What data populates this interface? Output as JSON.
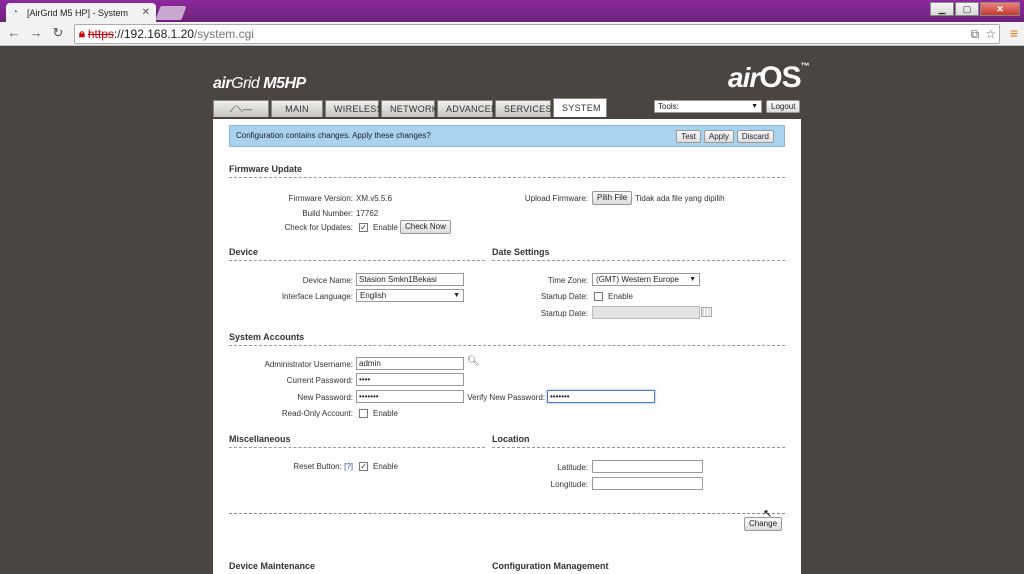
{
  "browser": {
    "tab_title": "[AirGrid M5 HP] - System",
    "url_protocol": "https",
    "url_host": "://192.168.1.20",
    "url_path": "/system.cgi"
  },
  "brand": {
    "left_prefix": "air",
    "left_main": "Grid",
    "left_model": "M5HP",
    "right_prefix": "air",
    "right_main": "OS",
    "right_tm": "™"
  },
  "nav": {
    "tabs": [
      "MAIN",
      "WIRELESS",
      "NETWORK",
      "ADVANCED",
      "SERVICES",
      "SYSTEM"
    ],
    "active": "SYSTEM",
    "tools_label": "Tools:",
    "logout_label": "Logout"
  },
  "notice": {
    "text": "Configuration contains changes. Apply these changes?",
    "test_label": "Test",
    "apply_label": "Apply",
    "discard_label": "Discard"
  },
  "firmware": {
    "title": "Firmware Update",
    "version_label": "Firmware Version:",
    "version_value": "XM.v5.5.6",
    "build_label": "Build Number:",
    "build_value": "17762",
    "check_label": "Check for Updates:",
    "check_enable": "Enable",
    "check_now_label": "Check Now",
    "upload_label": "Upload Firmware:",
    "choose_file_label": "Pilih File",
    "no_file_text": "Tidak ada file yang dipilih"
  },
  "device": {
    "title": "Device",
    "name_label": "Device Name:",
    "name_value": "Stasion Smkn1Bekasi",
    "lang_label": "Interface Language:",
    "lang_value": "English"
  },
  "date_settings": {
    "title": "Date Settings",
    "tz_label": "Time Zone:",
    "tz_value": "(GMT) Western Europe",
    "startup_label": "Startup Date:",
    "startup_enable": "Enable",
    "startup_date_label": "Startup Date:",
    "startup_date_value": ""
  },
  "accounts": {
    "title": "System Accounts",
    "admin_label": "Administrator Username:",
    "admin_value": "admin",
    "current_pw_label": "Current Password:",
    "current_pw_value": "••••",
    "new_pw_label": "New Password:",
    "new_pw_value": "•••••••",
    "verify_pw_label": "Verify New Password:",
    "verify_pw_value": "•••••••",
    "readonly_label": "Read-Only Account:",
    "readonly_enable": "Enable"
  },
  "misc": {
    "title": "Miscellaneous",
    "reset_label": "Reset Button:",
    "reset_help": "[?]",
    "reset_enable": "Enable"
  },
  "location": {
    "title": "Location",
    "lat_label": "Latitude:",
    "lat_value": "",
    "lon_label": "Longitude:",
    "lon_value": ""
  },
  "change_label": "Change",
  "maintenance": {
    "title": "Device Maintenance"
  },
  "config_mgmt": {
    "title": "Configuration Management"
  }
}
